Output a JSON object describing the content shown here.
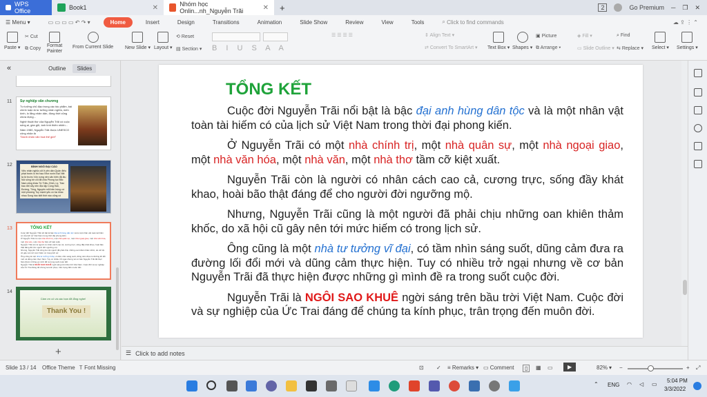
{
  "titlebar": {
    "wps": "WPS Office",
    "book": "Book1",
    "doc": "Nhóm học Onlin...nh_Nguyễn Trãi",
    "tab_count": "2",
    "premium": "Go Premium"
  },
  "menu": {
    "menu_label": "Menu",
    "items": [
      "Home",
      "Insert",
      "Design",
      "Transitions",
      "Animation",
      "Slide Show",
      "Review",
      "View",
      "Tools"
    ],
    "search_placeholder": "Click to find commands"
  },
  "ribbon": {
    "paste": "Paste",
    "cut": "Cut",
    "copy": "Copy",
    "format_painter": "Format\nPainter",
    "from_current_slide": "From Current Slide",
    "new_slide": "New Slide",
    "layout": "Layout",
    "reset": "Reset",
    "section": "Section",
    "align_text": "Align Text",
    "convert": "Convert To SmartArt",
    "text_box": "Text Box",
    "shapes": "Shapes",
    "picture": "Picture",
    "arrange": "Arrange",
    "fill": "Fill",
    "slide_outline": "Slide Outline",
    "find": "Find",
    "replace": "Replace",
    "select": "Select",
    "settings": "Settings"
  },
  "pane": {
    "outline": "Outline",
    "slides": "Slides"
  },
  "thumbs": {
    "t11": {
      "num": "11",
      "title": "Sự nghiệp văn chương",
      "bullets": [
        "Tư tưởng chủ đạo trong các tác phẩm, bài chính luận là tư tưởng nhân nghĩa, mến kính, lo lắng nhân dân, đồng thời cũng chứa đựng...",
        "Nghệ thuật thơ của Nguyễn Trãi có cuộc sống ai, gần gũi, ánh tình thiên nhiên...",
        "Năm 1980, Nguyễn Trãi được UNESCO công nhận là"
      ],
      "quote": "\"Danh nhân văn hoá thế giới\""
    },
    "t12": {
      "num": "12",
      "title": "BÌNH NGÔ ĐẠI CÁO",
      "text": "Việc nhân nghĩa cốt ở yên dân Quân điếu phạt trước lo trừ bạo Như nước Đại Việt ta từ trước Vốn xưng nền văn hiến đã lâu Núi sông bờ cõi đã chia Phong tục Bắc Nam cũng khác Từ Triệu, Đinh, Lý, Trần bao đời xây nền độc lập Cùng Hán, Đường, Tống, Nguyên mỗi bên hùng cứ một phương Tuy mạnh yếu có lúc khác nhau Song hào kiệt thời nào cũng có"
    },
    "t13": {
      "num": "13",
      "title": "TỔNG KẾT"
    },
    "t14": {
      "num": "14",
      "subtitle": "Cảm ơn cô và các bạn đã lắng nghe!",
      "thanks": "Thank You !"
    }
  },
  "slide": {
    "title": "TỔNG KẾT",
    "p1": {
      "a": "Cuộc đời Nguyễn Trãi nổi bật là bậc ",
      "b": "đại anh hùng dân tộc",
      "c": " và là một nhân vật toàn tài hiếm có của lịch sử Việt Nam trong thời đại phong kiến."
    },
    "p2": {
      "a": "Ở Nguyễn Trãi có một ",
      "b": "nhà chính trị",
      "c": ", một ",
      "d": "nhà quân sự",
      "e": ", một ",
      "f": "nhà ngoại giao",
      "g": ", một ",
      "h": "nhà văn hóa",
      "i": ", một ",
      "j": "nhà văn",
      "k": ", một ",
      "l": "nhà thơ",
      "m": " tầm cỡ kiệt xuất."
    },
    "p3": "Nguyễn Trãi còn là người có nhân cách cao cả, cương trực, sống đầy khát khao, hoài bão thật đáng để cho người đời ngưỡng mộ.",
    "p4": "Nhưng, Nguyễn Trãi cũng là một người đã phải chịu những oan khiên thảm khốc, do xã hội cũ gây nên tới mức hiếm có trong lịch sử.",
    "p5": {
      "a": "Ông cũng là một ",
      "b": "nhà tư tưởng vĩ đại",
      "c": ", có tầm nhìn sáng suốt, dũng cảm đưa ra đường lối đổi mới và dũng cảm thực hiện. Tuy có nhiều trở ngại nhưng về cơ bản Nguyễn Trãi đã thực hiện được những gì mình đề ra trong suốt cuộc đời."
    },
    "p6": {
      "a": "Nguyễn Trãi là ",
      "b": "NGÔI SAO KHUÊ",
      "c": " ngời sáng trên bầu trời Việt Nam. Cuộc đời và sự nghiệp của Ức Trai đáng để chúng ta kính phục, trân trọng đến muôn đời."
    }
  },
  "notes": {
    "placeholder": "Click to add notes"
  },
  "status": {
    "slide": "Slide 13 / 14",
    "theme": "Office Theme",
    "font": "Font Missing",
    "remarks": "Remarks",
    "comment": "Comment",
    "zoom": "82%"
  },
  "taskbar": {
    "lang": "ENG",
    "time": "5:04 PM",
    "date": "3/3/2022"
  },
  "colors": {
    "accent": "#f05b41",
    "title_green": "#1fa33a",
    "blue": "#2471d1",
    "red": "#d82424"
  }
}
